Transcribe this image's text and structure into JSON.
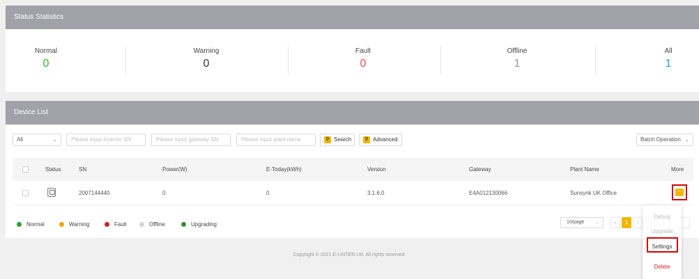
{
  "stats": {
    "title": "Status Statistics",
    "items": [
      {
        "label": "Normal",
        "value": "0",
        "color": "#2db82d"
      },
      {
        "label": "Warning",
        "value": "0",
        "color": "#333333"
      },
      {
        "label": "Fault",
        "value": "0",
        "color": "#ef4c4c"
      },
      {
        "label": "Offline",
        "value": "1",
        "color": "#999999"
      },
      {
        "label": "All",
        "value": "1",
        "color": "#29a3d8"
      }
    ]
  },
  "device_list": {
    "title": "Device List",
    "toolbar": {
      "status_select": "All",
      "inverter_sn_placeholder": "Please input inverter SN",
      "gateway_sn_placeholder": "Please input gateway SN",
      "plant_name_placeholder": "Please input plant name",
      "search_label": "Search",
      "advanced_label": "Advanced",
      "batch_label": "Batch Operation"
    },
    "columns": [
      "Status",
      "SN",
      "Power(W)",
      "E-Today(kWh)",
      "Version",
      "Gateway",
      "Plant Name",
      "More"
    ],
    "rows": [
      {
        "sn": "2007144440",
        "power": "0",
        "e_today": "0",
        "version": "3.1.6.0",
        "gateway": "E4A012130066",
        "plant_name": "Sunsynk UK Office"
      }
    ],
    "legend": [
      {
        "label": "Normal",
        "color": "#2e9e3a"
      },
      {
        "label": "Warning",
        "color": "#f0a500"
      },
      {
        "label": "Fault",
        "color": "#d41f1f"
      },
      {
        "label": "Offline",
        "color": "#d5d5d5"
      },
      {
        "label": "Upgrading",
        "color": "#3a8a3a"
      }
    ],
    "pagination": {
      "page_size": "10/page",
      "current_page": "1"
    }
  },
  "more_menu": {
    "items": [
      "Debug",
      "Upgrade",
      "Settings",
      "Delete"
    ]
  },
  "footer": {
    "copyright": "Copyright © 2021 E-LINTER Ltd. All rights reserved."
  },
  "icons": {
    "more": "more-icon",
    "search": "search-icon",
    "advanced": "advanced-icon",
    "device": "inverter-icon"
  }
}
